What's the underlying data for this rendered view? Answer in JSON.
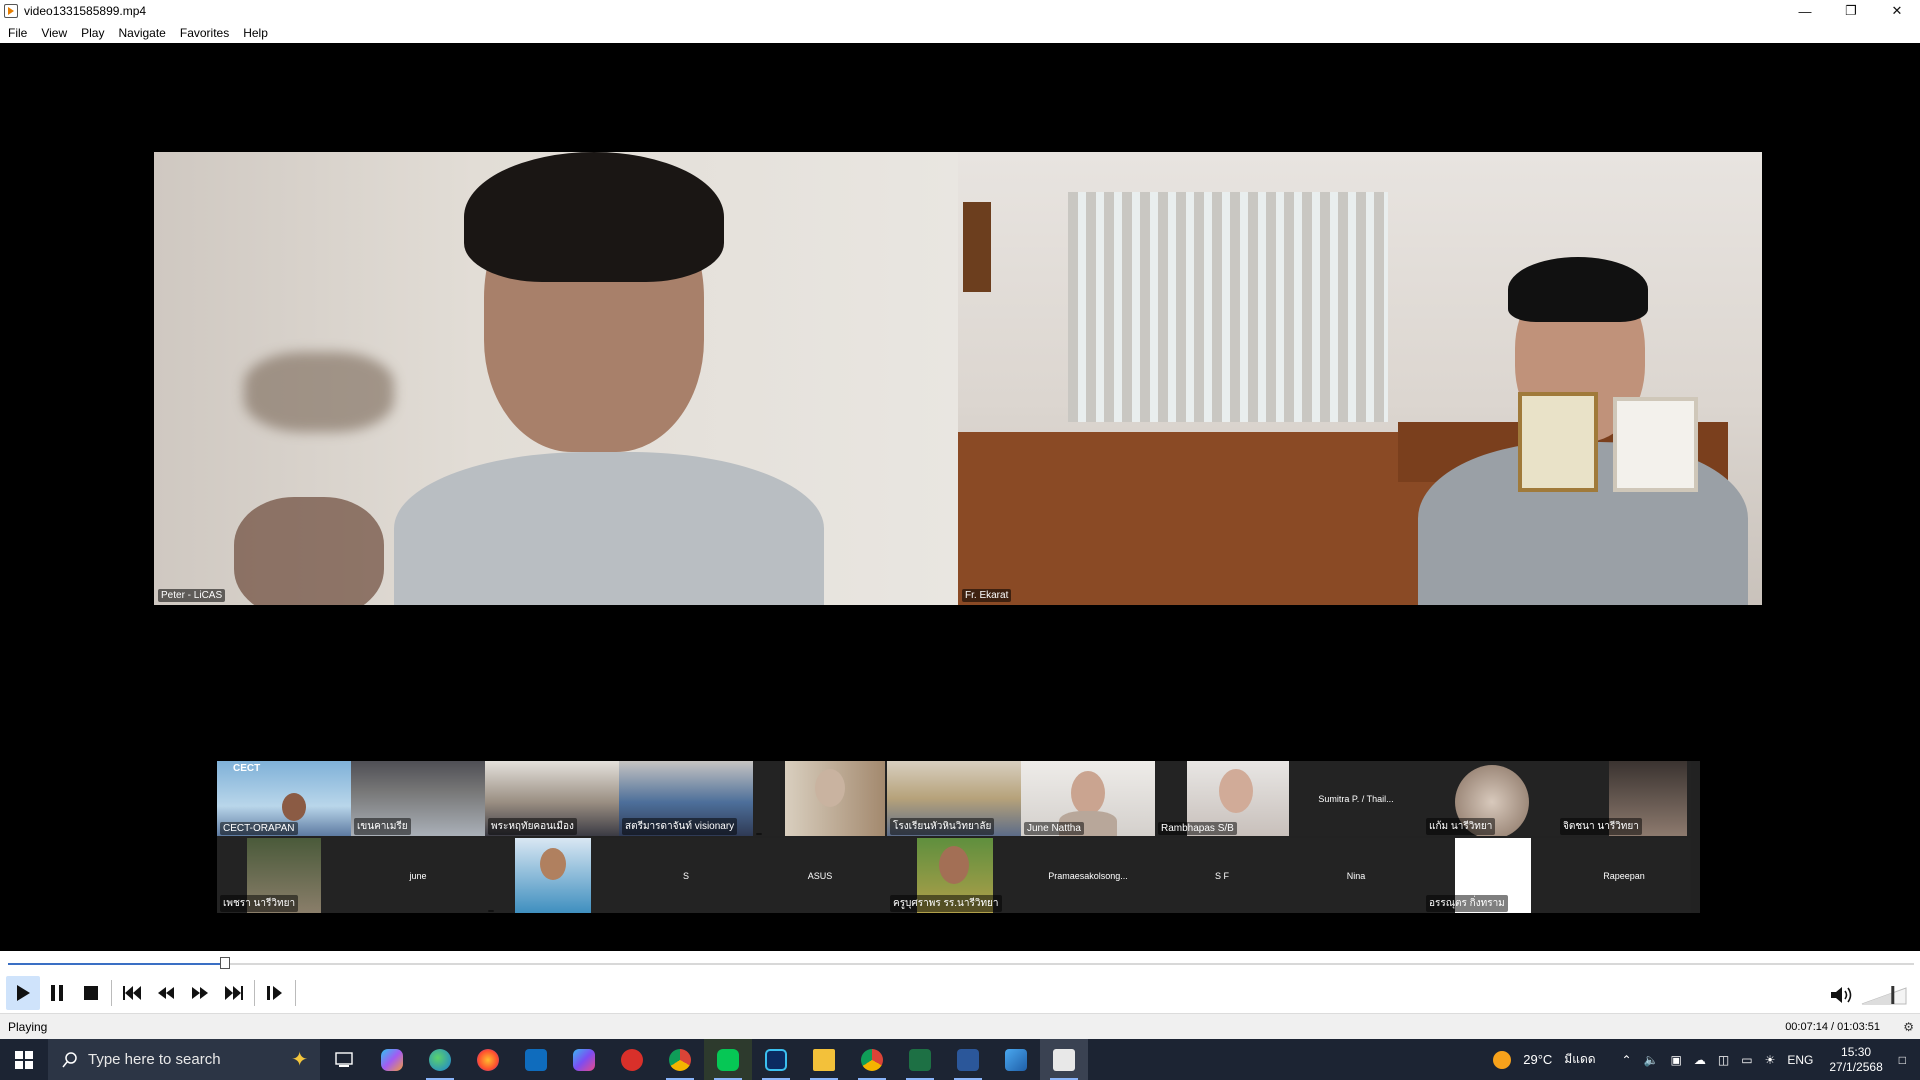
{
  "window": {
    "title": "video1331585899.mp4"
  },
  "menu": [
    "File",
    "View",
    "Play",
    "Navigate",
    "Favorites",
    "Help"
  ],
  "main_tiles": [
    {
      "name": "Peter - LiCAS"
    },
    {
      "name": "Fr. Ekarat"
    }
  ],
  "thumbnails": [
    {
      "label": "CECT-ORAPAN",
      "logo": "CECT"
    },
    {
      "label": "เขนคาเมรีย"
    },
    {
      "label": "พระหฤทัยคอนเมือง"
    },
    {
      "label": "สตรีมารดาจันท์ visionary"
    },
    {
      "label": ""
    },
    {
      "label": "โรงเรียนหัวหินวิทยาลัย"
    },
    {
      "label": "June Nattha"
    },
    {
      "label": "Rambhapas S/B"
    },
    {
      "label": "Sumitra P. / Thail..."
    },
    {
      "label": "แก้ม นารีวิทยา"
    },
    {
      "label": "จิตชนา นารีวิทยา"
    },
    {
      "label": "เพชรา นารีวิทยา"
    },
    {
      "label": "june"
    },
    {
      "label": ""
    },
    {
      "label": "S"
    },
    {
      "label": "ASUS"
    },
    {
      "label": "ครูบุศราพร รร.นารีวิทยา"
    },
    {
      "label": "Pramaesakolsong..."
    },
    {
      "label": "S F"
    },
    {
      "label": "Nina"
    },
    {
      "label": "อรรณุตร กิ่งทราม"
    },
    {
      "label": "Rapeepan"
    }
  ],
  "player": {
    "progress": 0.114,
    "status": "Playing",
    "time": "00:07:14 / 01:03:51",
    "volume": 0.7
  },
  "taskbar": {
    "search_placeholder": "Type here to search",
    "weather": "29°C",
    "weather_desc": "มีแดด",
    "lang": "ENG",
    "time": "15:30",
    "date": "27/1/2568"
  },
  "colors": {
    "accent": "#3a6fc4",
    "taskbar": "#1c2433"
  }
}
